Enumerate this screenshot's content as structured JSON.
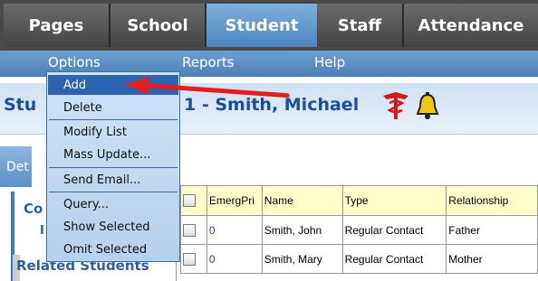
{
  "tabs": [
    {
      "label": "Pages"
    },
    {
      "label": "School"
    },
    {
      "label": "Student"
    },
    {
      "label": "Staff"
    },
    {
      "label": "Attendance"
    }
  ],
  "menu": {
    "options": "Options",
    "reports": "Reports",
    "help": "Help"
  },
  "student_header": {
    "prefix": "Stu",
    "name": "1 - Smith, Michael"
  },
  "side": {
    "det_tab": "Det",
    "co_label": "Co",
    "small_i": "I",
    "related_students": "Related Students"
  },
  "dropdown": {
    "items": [
      "Add",
      "Delete",
      "Modify List",
      "Mass Update...",
      "Send Email...",
      "Query...",
      "Show Selected",
      "Omit Selected"
    ],
    "highlighted": "Add"
  },
  "table": {
    "headers": [
      "",
      "EmergPri",
      "Name",
      "Type",
      "Relationship"
    ],
    "rows": [
      {
        "emerg": "0",
        "name": "Smith, John",
        "type": "Regular Contact",
        "relationship": "Father"
      },
      {
        "emerg": "0",
        "name": "Smith, Mary",
        "type": "Regular Contact",
        "relationship": "Mother"
      }
    ]
  },
  "colors": {
    "active_tab": "#5f95cc",
    "menubar": "#5d8fc4",
    "dropdown_highlight": "#2e63b0",
    "arrow": "#e21f1f",
    "title_text": "#1a4fa0",
    "header_cell": "#ffffcc"
  },
  "icons": [
    "medical-caduceus-icon",
    "bell-icon",
    "red-arrow-annotation"
  ]
}
